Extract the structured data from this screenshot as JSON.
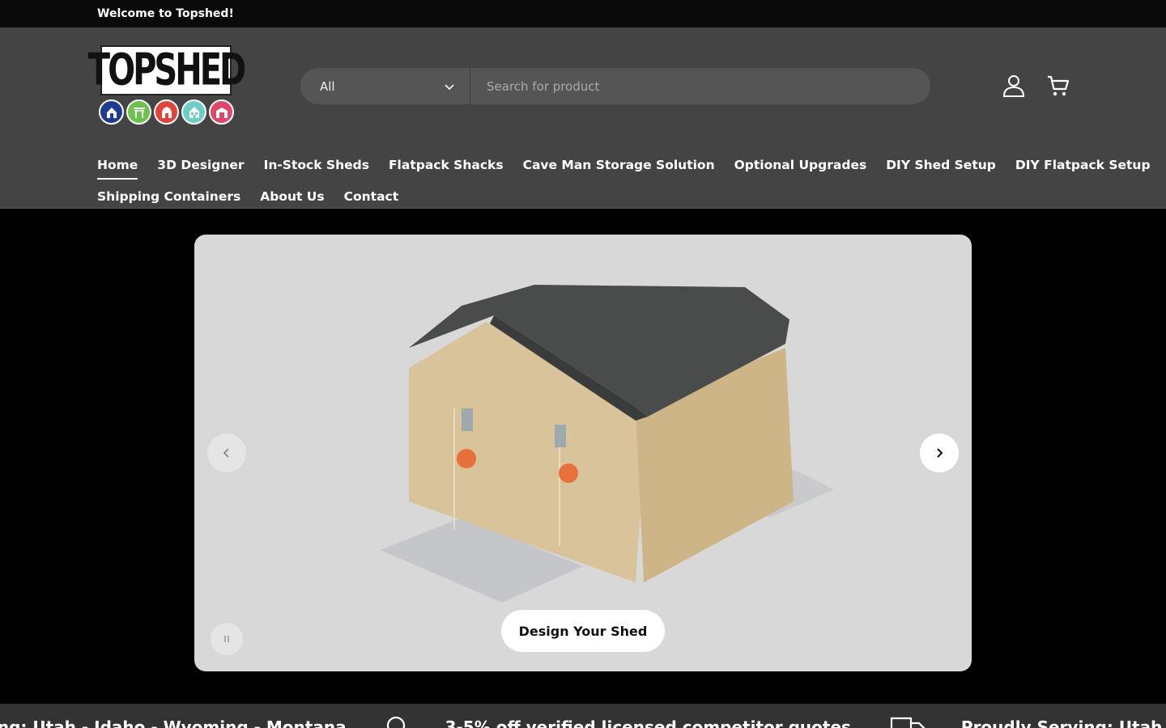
{
  "announcement": "Welcome to Topshed!",
  "logo": {
    "word": "TOPSHED",
    "circle_colors": [
      "#1f3b8f",
      "#6cc24a",
      "#e0443a",
      "#6bcfc8",
      "#e0466a"
    ]
  },
  "search": {
    "category": "All",
    "placeholder": "Search for product"
  },
  "icons": {
    "account": "user-icon",
    "cart": "cart-icon"
  },
  "nav": {
    "row1": [
      "Home",
      "3D Designer",
      "In-Stock Sheds",
      "Flatpack Shacks",
      "Cave Man Storage Solution",
      "Optional Upgrades",
      "DIY Shed Setup",
      "DIY Flatpack Setup"
    ],
    "row2": [
      "Shipping Containers",
      "About Us",
      "Contact"
    ],
    "active": "Home"
  },
  "hero": {
    "cta": "Design Your Shed"
  },
  "marquee": {
    "items": [
      "ing: Utah - Idaho - Wyoming - Montana",
      "3-5% off verified licensed competitor quotes",
      "Proudly Serving: Utah - Idaho - Wyoming"
    ]
  },
  "colors": {
    "header_bg": "#444444",
    "page_bg": "#000000",
    "accent": "#ffffff"
  }
}
